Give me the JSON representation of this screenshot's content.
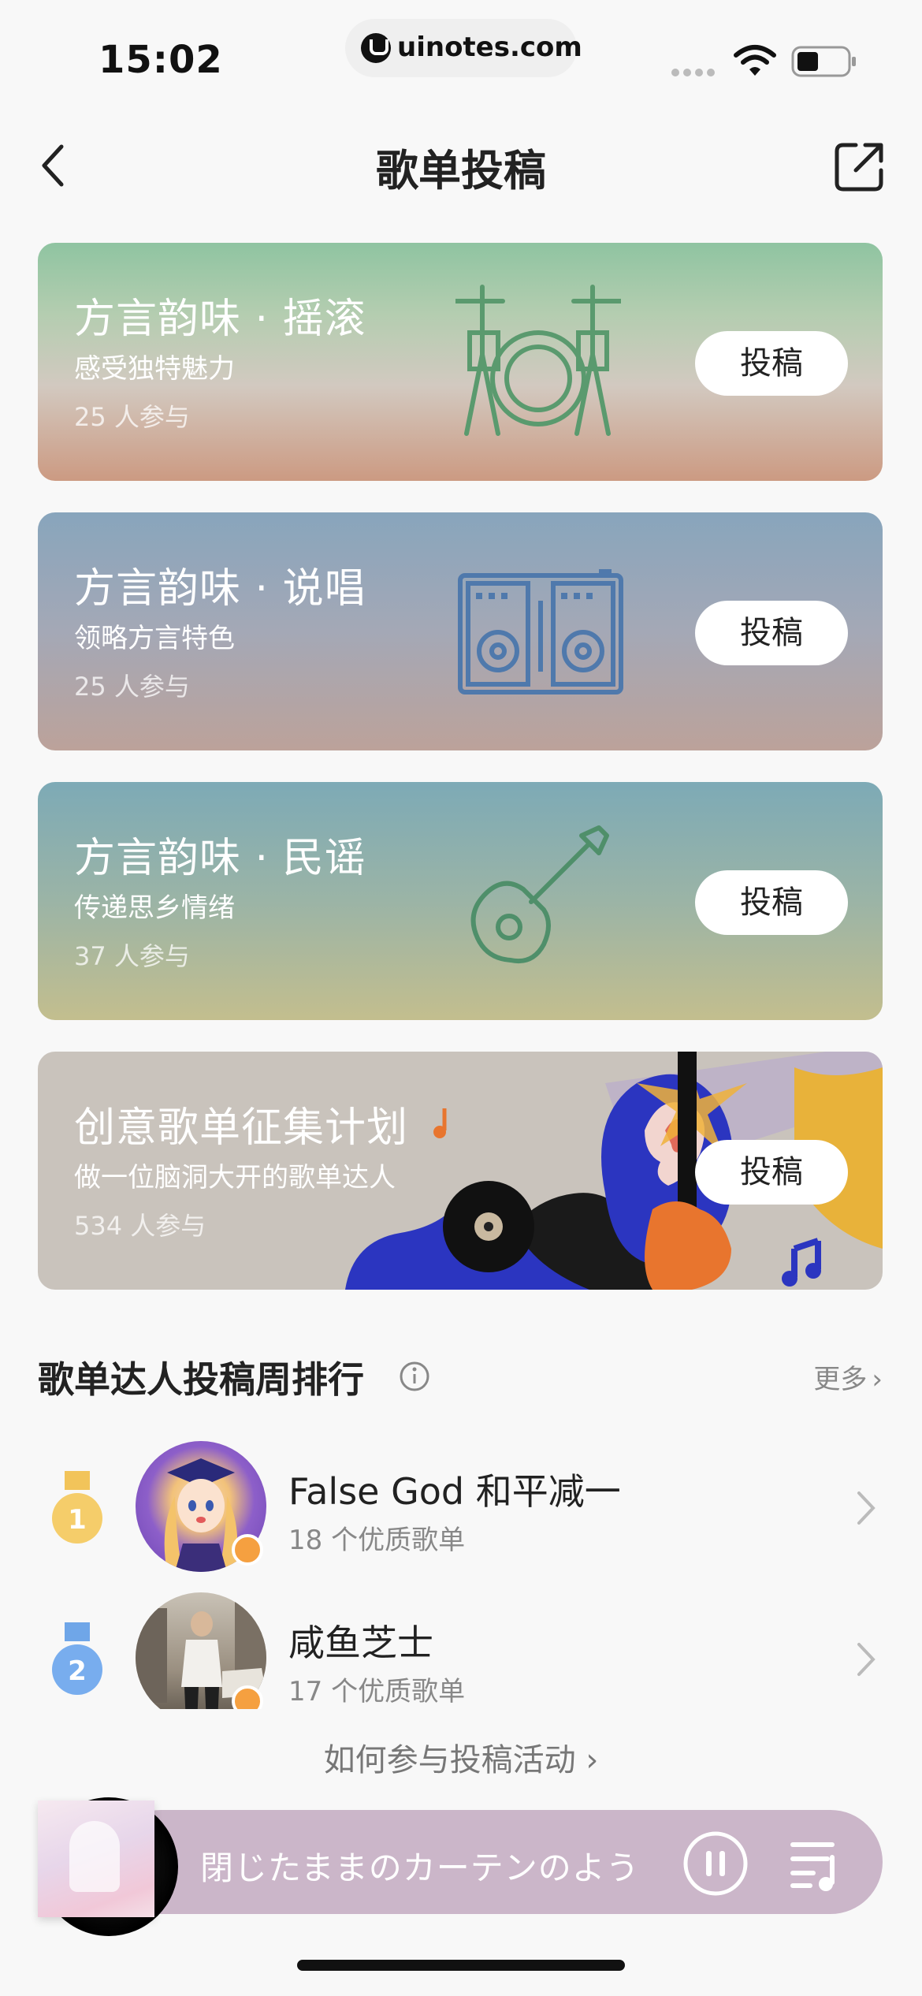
{
  "status_bar": {
    "time": "15:02",
    "url": "uinotes.com"
  },
  "nav": {
    "title": "歌单投稿",
    "back_icon": "chevron-left-icon",
    "share_icon": "share-external-icon"
  },
  "cards": [
    {
      "title": "方言韵味 · 摇滚",
      "subtitle": "感受独特魅力",
      "participants": "25 人参与",
      "button": "投稿",
      "illustration": "drum-kit-icon"
    },
    {
      "title": "方言韵味 · 说唱",
      "subtitle": "领略方言特色",
      "participants": "25 人参与",
      "button": "投稿",
      "illustration": "dj-controller-icon"
    },
    {
      "title": "方言韵味 · 民谣",
      "subtitle": "传递思乡情绪",
      "participants": "37 人参与",
      "button": "投稿",
      "illustration": "acoustic-guitar-icon"
    },
    {
      "title": "创意歌单征集计划",
      "subtitle": "做一位脑洞大开的歌单达人",
      "participants": "534 人参与",
      "button": "投稿",
      "illustration": "music-collage-illustration"
    }
  ],
  "ranking": {
    "title": "歌单达人投稿周排行",
    "more": "更多",
    "items": [
      {
        "rank": "1",
        "name": "False God 和平减一",
        "count": "18 个优质歌单"
      },
      {
        "rank": "2",
        "name": "咸鱼芝士",
        "count": "17 个优质歌单"
      }
    ]
  },
  "how_to": "如何参与投稿活动",
  "player": {
    "song": "閉じたままのカーテンのよう"
  },
  "colors": {
    "gold_medal": "#f2c45a",
    "silver_medal": "#6fa6e8",
    "player_bg": "#cbb6c9"
  }
}
